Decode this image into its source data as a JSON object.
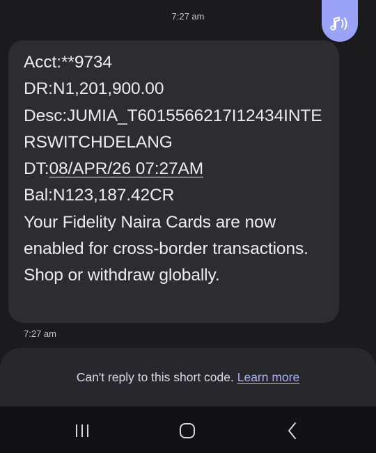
{
  "status": {
    "top_time": "7:27 am"
  },
  "tts": {
    "icon": "speaker-note-icon",
    "color": "#9aa3f5"
  },
  "message": {
    "acct": "Acct:**9734",
    "dr": "DR:N1,201,900.00",
    "desc_line1": "Desc:JUMIA_T6015566217I12434INTE",
    "desc_line2": "RSWITCHDELANG",
    "dt_prefix": "DT:",
    "dt_link": "08/APR/26 07:27AM",
    "bal": "Bal:N123,187.42CR",
    "note": "Your Fidelity Naira Cards are now enabled for cross-border transactions. Shop or withdraw globally.",
    "time": "7:27 am"
  },
  "reply": {
    "notice": "Can't reply to this short code.",
    "learn_more": "Learn more",
    "link_color": "#a9b1f7"
  },
  "nav": {
    "recents_icon": "recents-icon",
    "home_icon": "home-icon",
    "back_icon": "back-icon"
  }
}
